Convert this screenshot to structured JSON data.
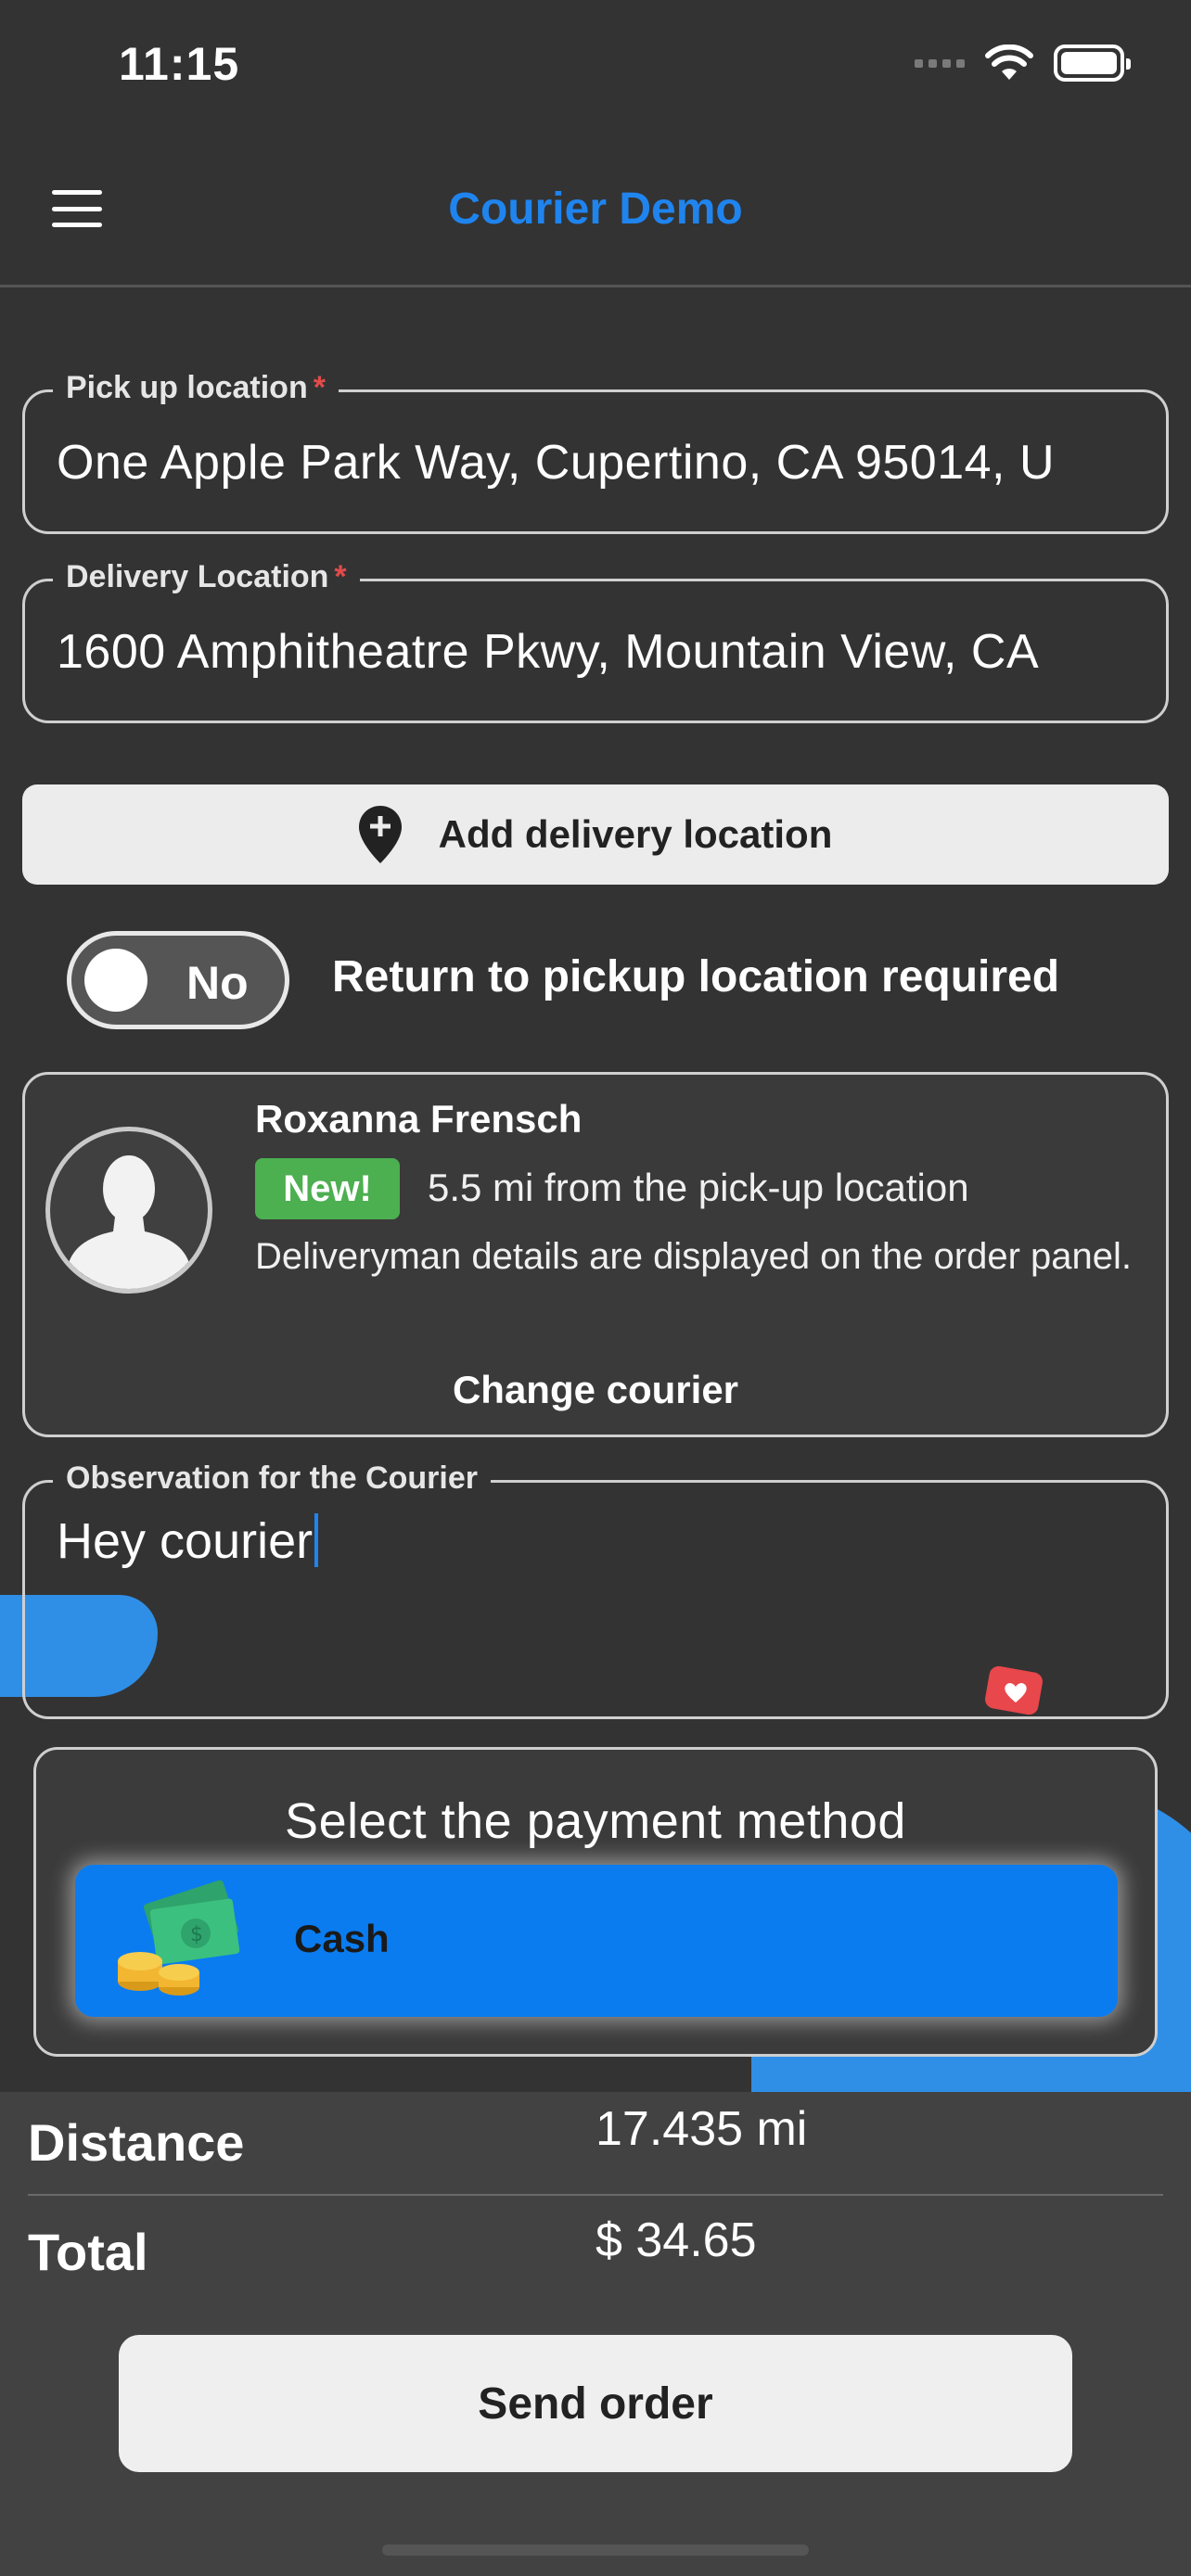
{
  "status_bar": {
    "time": "11:15"
  },
  "header": {
    "title": "Courier Demo"
  },
  "pickup": {
    "label": "Pick up location",
    "required_mark": "*",
    "value": "One Apple Park Way, Cupertino, CA 95014, U"
  },
  "delivery": {
    "label": "Delivery Location",
    "required_mark": "*",
    "value": "1600 Amphitheatre Pkwy, Mountain View, CA"
  },
  "add_delivery": {
    "label": "Add delivery location"
  },
  "return_toggle": {
    "state_text": "No",
    "label": "Return to pickup location required"
  },
  "courier": {
    "name": "Roxanna Frensch",
    "badge": "New!",
    "distance": "5.5 mi from the pick-up location",
    "details": "Deliveryman details are displayed on the order panel.",
    "change_label": "Change courier"
  },
  "observation": {
    "label": "Observation for the Courier",
    "value": "Hey courier"
  },
  "payment": {
    "title": "Select the payment method",
    "method": "Cash"
  },
  "summary": {
    "distance_label": "Distance",
    "distance_value": "17.435 mi",
    "total_label": "Total",
    "total_value": "$ 34.65"
  },
  "send_button": {
    "label": "Send order"
  },
  "colors": {
    "accent": "#1f84ee",
    "background": "#333333",
    "badge_green": "#4caf50",
    "required_red": "#e24b4b"
  }
}
